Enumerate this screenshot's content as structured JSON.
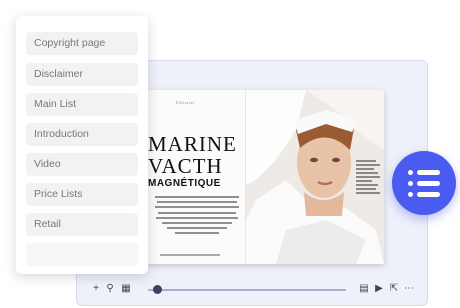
{
  "sidebar": {
    "items": [
      {
        "label": "Copyright page"
      },
      {
        "label": "Disclaimer"
      },
      {
        "label": "Main List"
      },
      {
        "label": "Introduction"
      },
      {
        "label": "Video"
      },
      {
        "label": "Price Lists"
      },
      {
        "label": "Retail"
      },
      {
        "label": ""
      }
    ]
  },
  "magazine": {
    "header": "Editorial",
    "title_line1": "MARINE",
    "title_line2": "VACTH",
    "title_line3": "MAGNÉTIQUE"
  },
  "toolbar": {
    "zoom_in_icon": "+",
    "search_icon": "⚲",
    "grid_icon": "▦",
    "bookmark_icon": "▤",
    "play_icon": "▶",
    "share_icon": "⇱",
    "more_icon": "⋯",
    "progress": 0.05
  },
  "colors": {
    "accent": "#4a5cf0",
    "viewer_bg": "#eef0fa"
  }
}
